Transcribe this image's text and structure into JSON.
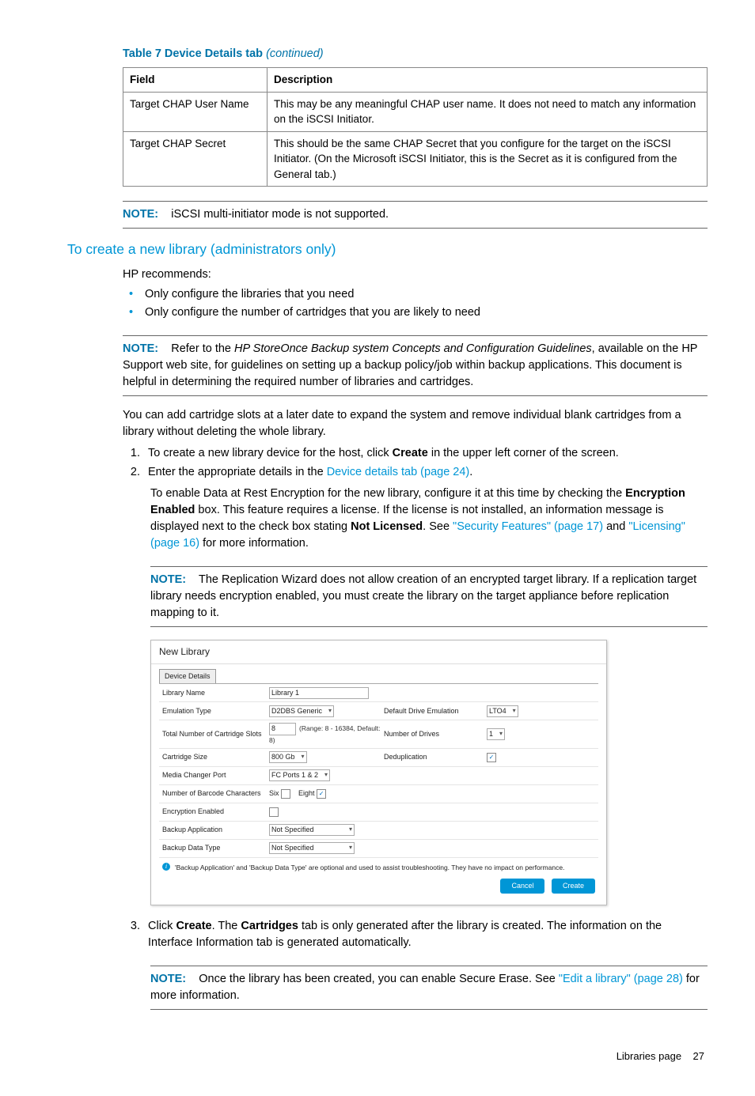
{
  "table": {
    "caption_prefix": "Table 7 Device Details tab",
    "caption_suffix": "(continued)",
    "headers": {
      "field": "Field",
      "desc": "Description"
    },
    "rows": [
      {
        "field": "Target CHAP User Name",
        "desc": "This may be any meaningful CHAP user name. It does not need to match any information on the iSCSI Initiator."
      },
      {
        "field": "Target CHAP Secret",
        "desc": "This should be the same CHAP Secret that you configure for the target on the iSCSI Initiator. (On the Microsoft iSCSI Initiator, this is the Secret as it is configured from the General tab.)"
      }
    ]
  },
  "notes": {
    "label": "NOTE:",
    "n1": "iSCSI multi-initiator mode is not supported.",
    "n2_a": "Refer to the ",
    "n2_b": "HP StoreOnce Backup system Concepts and Configuration Guidelines",
    "n2_c": ", available on the HP Support web site, for guidelines on setting up a backup policy/job within backup applications. This document is helpful in determining the required number of libraries and cartridges.",
    "n3": "The Replication Wizard does not allow creation of an encrypted target library. If a replication target library needs encryption enabled, you must create the library on the target appliance before replication mapping to it.",
    "n4_a": "Once the library has been created, you can enable Secure Erase. See ",
    "n4_link": "\"Edit a library\" (page 28)",
    "n4_b": " for more information."
  },
  "section_heading": "To create a new library (administrators only)",
  "intro": "HP recommends:",
  "bullets": {
    "b1": "Only configure the libraries that you need",
    "b2": "Only configure the number of cartridges that you are likely to need"
  },
  "para_expand": "You can add cartridge slots at a later date to expand the system and remove individual blank cartridges from a library without deleting the whole library.",
  "steps": {
    "s1_a": "To create a new library device for the host, click ",
    "s1_b": "Create",
    "s1_c": " in the upper left corner of the screen.",
    "s2_a": "Enter the appropriate details in the ",
    "s2_link": "Device details tab (page 24)",
    "s2_b": ".",
    "s2_det_a": "To enable Data at Rest Encryption for the new library, configure it at this time by checking the ",
    "s2_det_b": "Encryption Enabled",
    "s2_det_c": " box. This feature requires a license. If the license is not installed, an information message is displayed next to the check box stating ",
    "s2_det_d": "Not Licensed",
    "s2_det_e": ". See ",
    "s2_link2": "\"Security Features\" (page 17)",
    "s2_det_f": " and ",
    "s2_link3": "\"Licensing\" (page 16)",
    "s2_det_g": " for more information.",
    "s3_a": "Click ",
    "s3_b": "Create",
    "s3_c": ". The ",
    "s3_d": "Cartridges",
    "s3_e": " tab is only generated after the library is created. The information on the Interface Information tab is generated automatically."
  },
  "mock": {
    "title": "New Library",
    "tab": "Device Details",
    "rows": {
      "library_name": {
        "label": "Library Name",
        "value": "Library 1"
      },
      "emulation": {
        "label": "Emulation Type",
        "value": "D2DBS Generic",
        "label2": "Default Drive Emulation",
        "value2": "LTO4"
      },
      "slots": {
        "label": "Total Number of Cartridge Slots",
        "value": "8",
        "hint": "(Range: 8 - 16384, Default: 8)",
        "label2": "Number of Drives",
        "value2": "1"
      },
      "cartsize": {
        "label": "Cartridge Size",
        "value": "800 Gb",
        "label2": "Deduplication"
      },
      "mcport": {
        "label": "Media Changer Port",
        "value": "FC Ports 1 & 2"
      },
      "barcode": {
        "label": "Number of Barcode Characters",
        "six": "Six",
        "eight": "Eight"
      },
      "enc": {
        "label": "Encryption Enabled"
      },
      "bkapp": {
        "label": "Backup Application",
        "value": "Not Specified"
      },
      "bkdata": {
        "label": "Backup Data Type",
        "value": "Not Specified"
      }
    },
    "info": "'Backup Application' and 'Backup Data Type' are optional and used to assist troubleshooting. They have no impact on performance.",
    "btn_cancel": "Cancel",
    "btn_create": "Create"
  },
  "footer": {
    "text": "Libraries page",
    "num": "27"
  }
}
